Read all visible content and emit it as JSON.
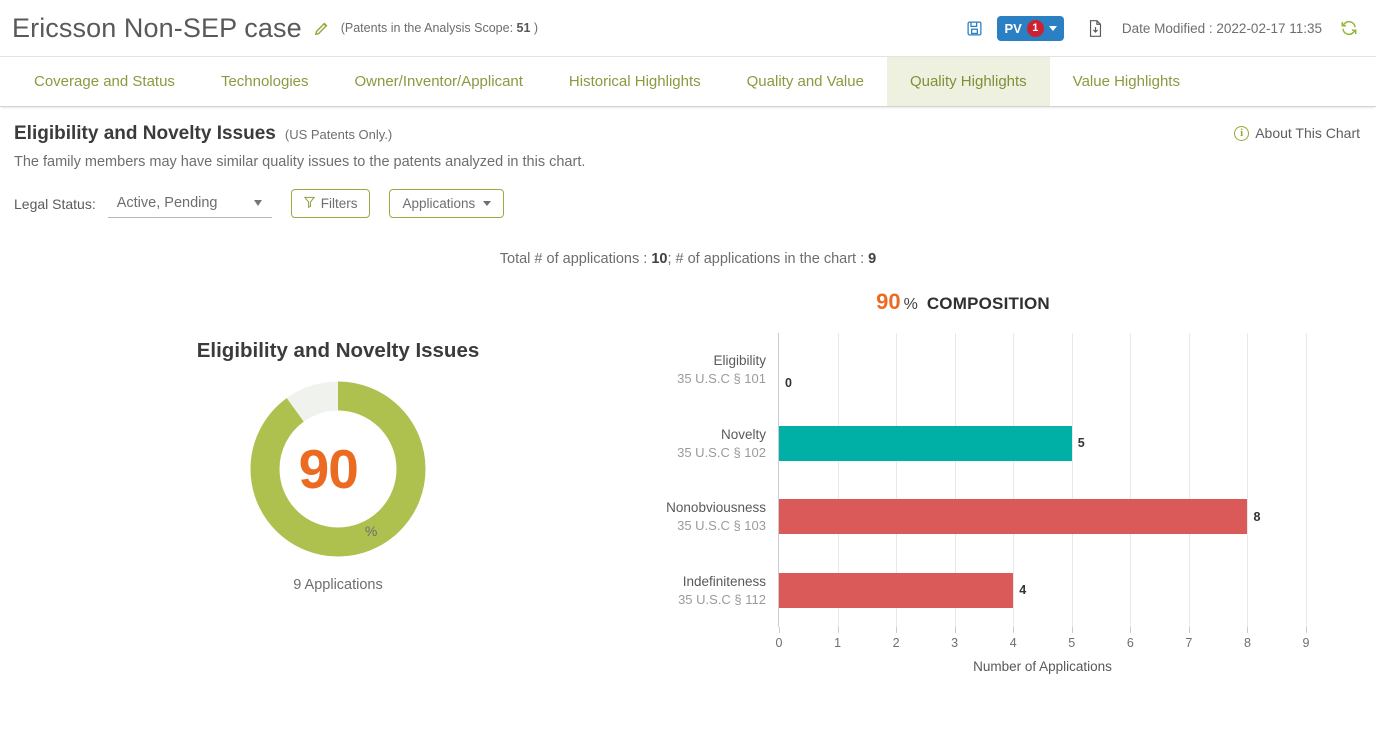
{
  "header": {
    "title": "Ericsson Non-SEP case",
    "edit_icon": "pencil-icon",
    "scope_prefix": "(Patents in the Analysis Scope: ",
    "scope_count": "51",
    "scope_suffix": " )",
    "save_icon": "save-disk-icon",
    "pv_label": "PV",
    "pv_count": "1",
    "export_icon": "export-file-icon",
    "date_modified": "Date Modified : 2022-02-17 11:35",
    "refresh_icon": "refresh-icon",
    "accent_blue": "#2b7fc3",
    "badge_red": "#cf2030"
  },
  "tabs": [
    {
      "label": "Coverage and Status",
      "active": false
    },
    {
      "label": "Technologies",
      "active": false
    },
    {
      "label": "Owner/Inventor/Applicant",
      "active": false
    },
    {
      "label": "Historical Highlights",
      "active": false
    },
    {
      "label": "Quality and Value",
      "active": false
    },
    {
      "label": "Quality Highlights",
      "active": true
    },
    {
      "label": "Value Highlights",
      "active": false
    }
  ],
  "panel": {
    "title": "Eligibility and Novelty Issues",
    "title_sub": "(US Patents Only.)",
    "about_label": "About This Chart",
    "about_icon": "info-circle-icon",
    "description": "The family members may have similar quality issues to the patents analyzed in this chart."
  },
  "filters": {
    "legal_status_label": "Legal Status:",
    "legal_status_value": "Active, Pending",
    "filters_button": "Filters",
    "filters_icon": "funnel-icon",
    "applications_button": "Applications"
  },
  "totals": {
    "prefix": "Total # of applications : ",
    "total": "10",
    "middle": "; # of applications in the chart : ",
    "in_chart": "9"
  },
  "donut": {
    "title": "Eligibility and Novelty Issues",
    "value": "90",
    "unit": "%",
    "caption": "9 Applications",
    "fill_color": "#aec14f",
    "track_color": "#f0f2ed",
    "value_color": "#ec6b22"
  },
  "composition": {
    "value": "90",
    "unit": "%",
    "label": "COMPOSITION"
  },
  "chart_data": {
    "type": "bar",
    "orientation": "horizontal",
    "title": "Eligibility and Novelty Issues",
    "xlabel": "Number of Applications",
    "ylabel": "",
    "xlim": [
      0,
      9
    ],
    "xticks": [
      0,
      1,
      2,
      3,
      4,
      5,
      6,
      7,
      8,
      9
    ],
    "grid": true,
    "legend": "none",
    "categories": [
      "Eligibility\n35 U.S.C § 101",
      "Novelty\n35 U.S.C § 102",
      "Nonobviousness\n35 U.S.C § 103",
      "Indefiniteness\n35 U.S.C § 112"
    ],
    "values": [
      0,
      5,
      8,
      4
    ],
    "bars": [
      {
        "name": "Eligibility",
        "statute": "35 U.S.C § 101",
        "value": 0,
        "color": "#00b0a6"
      },
      {
        "name": "Novelty",
        "statute": "35 U.S.C § 102",
        "value": 5,
        "color": "#00b0a6"
      },
      {
        "name": "Nonobviousness",
        "statute": "35 U.S.C § 103",
        "value": 8,
        "color": "#d95a58"
      },
      {
        "name": "Indefiniteness",
        "statute": "35 U.S.C § 112",
        "value": 4,
        "color": "#d95a58"
      }
    ]
  }
}
